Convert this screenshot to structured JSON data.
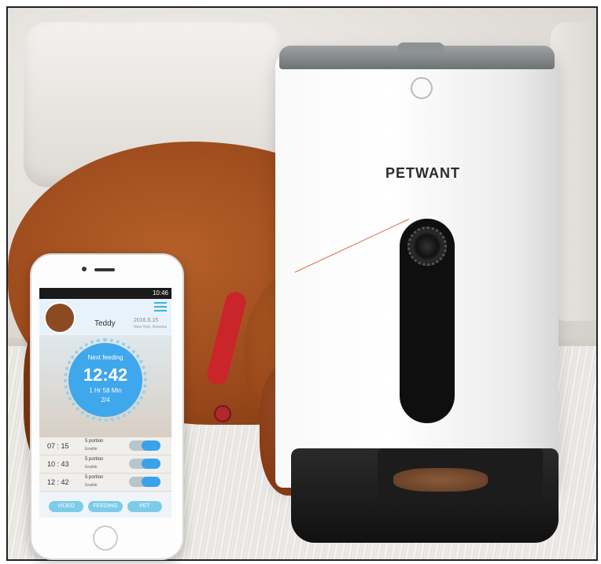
{
  "feeder": {
    "brand": "PETWANT"
  },
  "app": {
    "status_time": "10:46",
    "pet_name": "Teddy",
    "date": "2016.6.15",
    "location": "New York, America",
    "clock": {
      "label": "Next feeding",
      "time": "12:42",
      "remaining": "1 Hr 58 Min",
      "portion": "2/4"
    },
    "schedule": [
      {
        "time": "07 : 15",
        "portion": "5 portion",
        "status": "Enable"
      },
      {
        "time": "10 : 43",
        "portion": "5 portion",
        "status": "Enable"
      },
      {
        "time": "12 : 42",
        "portion": "5 portion",
        "status": "Enable"
      }
    ],
    "tabs": [
      "VIDEO",
      "FEEDING",
      "PET"
    ]
  }
}
